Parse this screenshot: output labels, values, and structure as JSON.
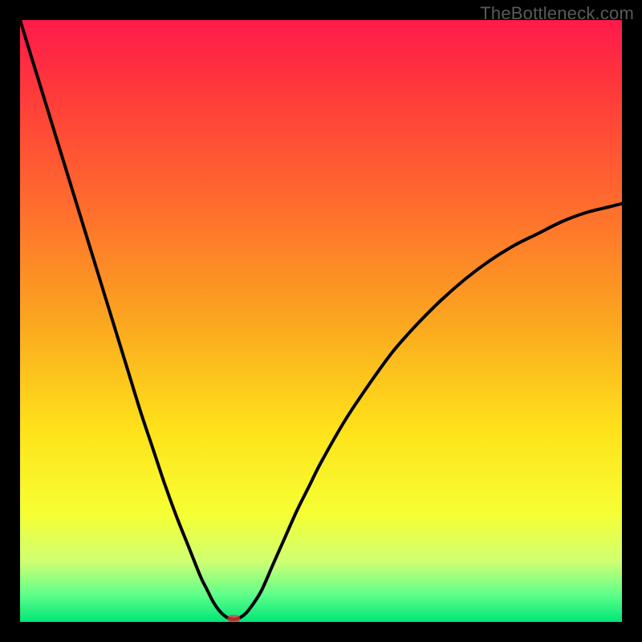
{
  "watermark": "TheBottleneck.com",
  "colors": {
    "bg_black": "#000000",
    "curve": "#000000",
    "marker": "#e43b3c",
    "gradient_stops": [
      {
        "offset": 0.0,
        "color": "#ff1a4a"
      },
      {
        "offset": 0.12,
        "color": "#ff3a3a"
      },
      {
        "offset": 0.3,
        "color": "#ff6a2e"
      },
      {
        "offset": 0.5,
        "color": "#fba61f"
      },
      {
        "offset": 0.68,
        "color": "#ffe21a"
      },
      {
        "offset": 0.82,
        "color": "#f6ff33"
      },
      {
        "offset": 0.9,
        "color": "#cfff73"
      },
      {
        "offset": 0.955,
        "color": "#5eff8a"
      },
      {
        "offset": 1.0,
        "color": "#00e676"
      }
    ]
  },
  "chart_data": {
    "type": "line",
    "title": "",
    "xlabel": "",
    "ylabel": "",
    "xlim": [
      0,
      100
    ],
    "ylim": [
      0,
      100
    ],
    "grid": false,
    "legend": false,
    "x": [
      0,
      2,
      4,
      6,
      8,
      10,
      12,
      14,
      16,
      18,
      20,
      22,
      24,
      26,
      28,
      30,
      31,
      32,
      33,
      34,
      35,
      36,
      37,
      38,
      40,
      42,
      44,
      46,
      48,
      50,
      54,
      58,
      62,
      66,
      70,
      74,
      78,
      82,
      86,
      90,
      94,
      98,
      100
    ],
    "values": [
      100,
      93.5,
      87,
      80.5,
      74,
      67.5,
      61,
      54.5,
      48,
      41.5,
      35,
      29,
      23,
      17.5,
      12.5,
      7.5,
      5.5,
      3.5,
      2,
      1,
      0.5,
      0.5,
      1,
      2,
      5,
      9.5,
      14,
      18.5,
      22.5,
      26.5,
      33.5,
      39.5,
      45,
      49.5,
      53.5,
      57,
      60,
      62.5,
      64.5,
      66.5,
      68,
      69,
      69.5
    ],
    "annotations": [],
    "marker_x": 35.5,
    "marker_y": 0.5,
    "marker_note": "small rounded red marker at the curve minimum"
  }
}
